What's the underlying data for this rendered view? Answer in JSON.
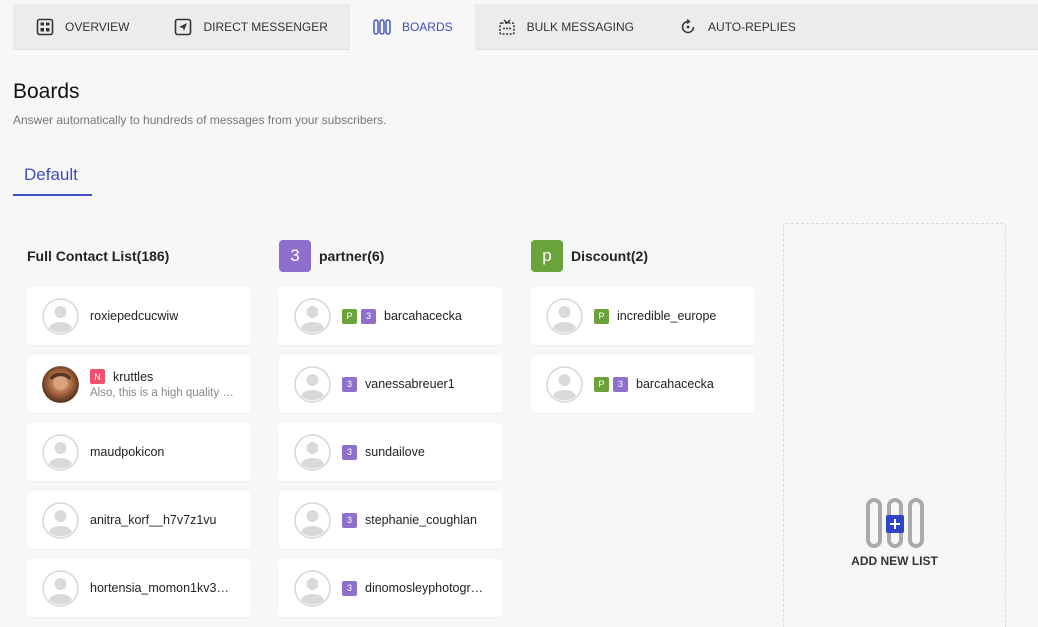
{
  "nav": {
    "tabs": [
      {
        "label": "OVERVIEW",
        "icon": "dashboard-icon"
      },
      {
        "label": "DIRECT MESSENGER",
        "icon": "send-icon"
      },
      {
        "label": "BOARDS",
        "icon": "columns-icon",
        "active": true
      },
      {
        "label": "BULK MESSAGING",
        "icon": "broadcast-icon"
      },
      {
        "label": "AUTO-REPLIES",
        "icon": "auto-reply-icon"
      }
    ]
  },
  "page": {
    "title": "Boards",
    "subtitle": "Answer automatically to hundreds of messages from your subscribers."
  },
  "board_tab": {
    "label": "Default"
  },
  "colors": {
    "accent": "#3f4fbd",
    "tag_p": "#6aa33a",
    "tag_3": "#8e6fcb",
    "tag_n": "#f0506e"
  },
  "columns": [
    {
      "title": "Full Contact List(186)",
      "badge": "",
      "cards": [
        {
          "name": "roxiepedcucwiw",
          "tags": [],
          "preview": ""
        },
        {
          "name": "kruttles",
          "tags": [
            "N"
          ],
          "preview": "Also, this is a high quality …",
          "photo": true
        },
        {
          "name": "maudpokicon",
          "tags": [],
          "preview": ""
        },
        {
          "name": "anitra_korf__h7v7z1vu",
          "tags": [],
          "preview": ""
        },
        {
          "name": "hortensia_momon1kv3…",
          "tags": [],
          "preview": ""
        }
      ]
    },
    {
      "title": "partner(6)",
      "badge": "3",
      "cards": [
        {
          "name": "barcahacecka",
          "tags": [
            "P",
            "3"
          ],
          "preview": ""
        },
        {
          "name": "vanessabreuer1",
          "tags": [
            "3"
          ],
          "preview": ""
        },
        {
          "name": "sundailove",
          "tags": [
            "3"
          ],
          "preview": ""
        },
        {
          "name": "stephanie_coughlan",
          "tags": [
            "3"
          ],
          "preview": ""
        },
        {
          "name": "dinomosleyphotogr…",
          "tags": [
            "3"
          ],
          "preview": ""
        }
      ]
    },
    {
      "title": "Discount(2)",
      "badge": "p",
      "cards": [
        {
          "name": "incredible_europe",
          "tags": [
            "P"
          ],
          "preview": ""
        },
        {
          "name": "barcahacecka",
          "tags": [
            "P",
            "3"
          ],
          "preview": ""
        }
      ]
    }
  ],
  "add_list": {
    "label": "ADD NEW LIST"
  }
}
